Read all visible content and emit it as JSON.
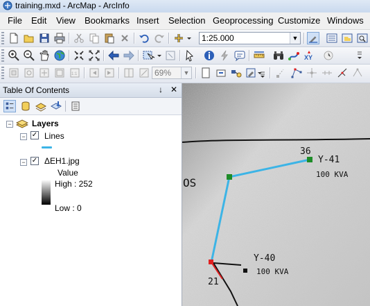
{
  "window": {
    "title": "training.mxd - ArcMap - ArcInfo"
  },
  "menu": [
    "File",
    "Edit",
    "View",
    "Bookmarks",
    "Insert",
    "Selection",
    "Geoprocessing",
    "Customize",
    "Windows"
  ],
  "standard_toolbar": {
    "scale_value": "1:25.000"
  },
  "effects_toolbar": {
    "transparency_value": "69%"
  },
  "toc": {
    "title": "Table Of Contents",
    "pin_glyph": "↓",
    "close_glyph": "✕",
    "group_label": "Layers",
    "layer1": {
      "name": "Lines",
      "checked": "✓",
      "expander": "−"
    },
    "layer2": {
      "name": "ΔEH1.jpg",
      "checked": "✓",
      "expander": "−"
    },
    "legend": {
      "value_label": "Value",
      "high_label": "High : 252",
      "low_label": "Low : 0"
    },
    "group_expander": "−"
  },
  "map": {
    "line_color": "#3cb4e6",
    "node_color": "#1e8c28",
    "end_node_color": "#e02020",
    "annotations": [
      "36",
      "Y-41",
      "100 KVA",
      "Y-40",
      "100 KVA",
      "21",
      "OS"
    ]
  }
}
